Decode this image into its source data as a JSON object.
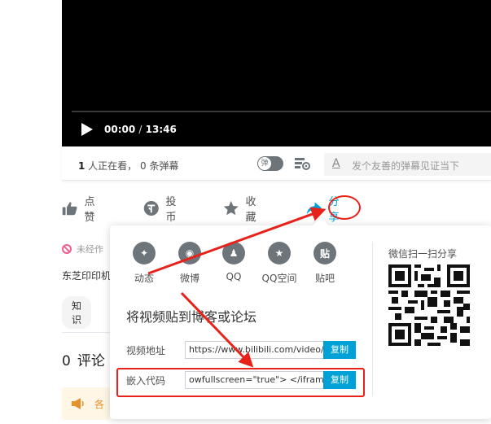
{
  "player": {
    "current_time": "00:00",
    "separator": "/",
    "duration": "13:46"
  },
  "danmaku": {
    "viewers_count": "1",
    "viewers_text": " 人正在看， 0 条弹幕",
    "toggle_label": "弹",
    "input_icon": "A",
    "input_placeholder": "发个友善的弹幕见证当下"
  },
  "actions": {
    "like": "点赞",
    "coin": "投币",
    "favorite": "收藏",
    "share": "分享"
  },
  "content": {
    "notice": "未经作",
    "description": "东芝印印机",
    "tag": "知识",
    "comments_count": "0",
    "comments_label": "评论",
    "announcement": "各"
  },
  "share_popup": {
    "platforms": [
      {
        "label": "动态",
        "glyph": "✦"
      },
      {
        "label": "微博",
        "glyph": "◉"
      },
      {
        "label": "QQ",
        "glyph": "♟"
      },
      {
        "label": "QQ空间",
        "glyph": "★"
      },
      {
        "label": "贴吧",
        "glyph": "贴"
      }
    ],
    "embed_title": "将视频贴到博客或论坛",
    "video_url_label": "视频地址",
    "video_url_value": "https://www.bilibili.com/video/E",
    "embed_code_label": "嵌入代码",
    "embed_code_value": "owfullscreen=\"true\"> </iframe>",
    "copy_label": "复制",
    "qr_title": "微信扫一扫分享"
  },
  "colors": {
    "accent": "#00a1d6",
    "annotation_red": "#e8221a",
    "icon_gray": "#6d757a"
  }
}
